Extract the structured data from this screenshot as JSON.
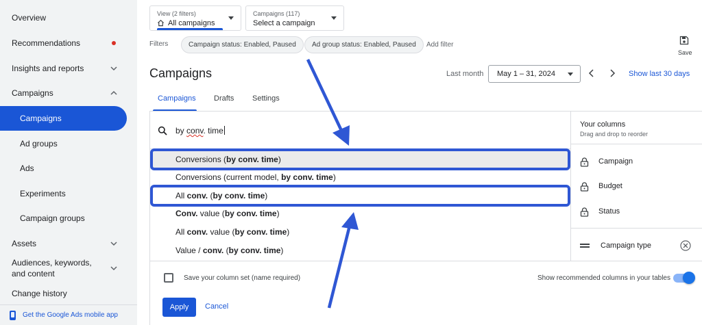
{
  "sidebar": {
    "overview": "Overview",
    "recommendations": "Recommendations",
    "insights": "Insights and reports",
    "campaigns": "Campaigns",
    "sub_campaigns": "Campaigns",
    "ad_groups": "Ad groups",
    "ads": "Ads",
    "experiments": "Experiments",
    "campaign_groups": "Campaign groups",
    "assets": "Assets",
    "audiences": "Audiences, keywords, and content",
    "change_history": "Change history",
    "mobile_app": "Get the Google Ads mobile app"
  },
  "toolbar": {
    "view_small": "View (2 filters)",
    "view_value": "All campaigns",
    "campaigns_small": "Campaigns (117)",
    "campaigns_value": "Select a campaign",
    "filters_label": "Filters",
    "chip_campaign_status": "Campaign status: Enabled, Paused",
    "chip_adgroup_status": "Ad group status: Enabled, Paused",
    "add_filter": "Add filter",
    "save_label": "Save"
  },
  "header": {
    "title": "Campaigns",
    "date_label": "Last month",
    "date_range": "May 1 – 31, 2024",
    "show_last": "Show last 30 days"
  },
  "tabs": [
    "Campaigns",
    "Drafts",
    "Settings"
  ],
  "search": {
    "value_plain": "by ",
    "value_squiggle": "conv",
    "value_tail": ". time"
  },
  "results": [
    {
      "pre": "Conversions (",
      "bold": "by conv. time",
      "post": ")"
    },
    {
      "pre": "Conversions (current model, ",
      "bold": "by conv. time",
      "post": ")"
    },
    {
      "pre": "All ",
      "bold": "conv.",
      "pre2": " (",
      "bold2": "by conv. time",
      "post": ")"
    },
    {
      "pre": "",
      "bold": "Conv.",
      "pre2": " value (",
      "bold2": "by conv. time",
      "post": ")"
    },
    {
      "pre": "All ",
      "bold": "conv.",
      "pre2": " value (",
      "bold2": "by conv. time",
      "post": ")"
    },
    {
      "pre": "Value / ",
      "bold": "conv.",
      "pre2": " (",
      "bold2": "by conv. time",
      "post": ")"
    }
  ],
  "your_columns": {
    "title": "Your columns",
    "subtitle": "Drag and drop to reorder",
    "items": [
      "Campaign",
      "Budget",
      "Status",
      "Campaign type"
    ]
  },
  "footer": {
    "save_set": "Save your column set (name required)",
    "show_recommended": "Show recommended columns in your tables",
    "apply": "Apply",
    "cancel": "Cancel"
  },
  "colors": {
    "accent": "#1a56d6",
    "annotation": "#2f57d4",
    "alert_dot": "#d93025"
  },
  "icons": [
    "home-icon",
    "caret-down-icon",
    "chevron-down-icon",
    "chevron-up-icon",
    "save-icon",
    "chevron-left-icon",
    "chevron-right-icon",
    "search-icon",
    "lock-icon",
    "drag-handle-icon",
    "remove-circle-icon",
    "phone-icon",
    "checkbox-icon",
    "toggle-icon",
    "annotation-arrow-icon"
  ]
}
